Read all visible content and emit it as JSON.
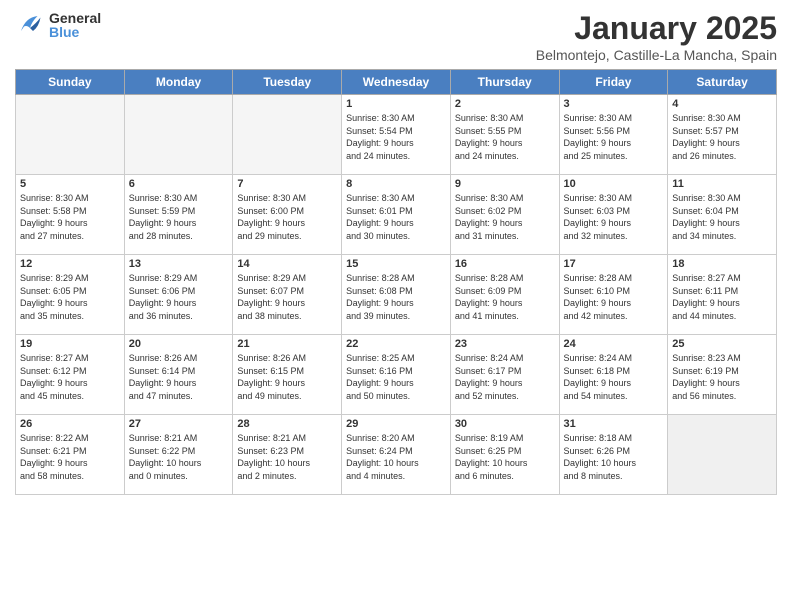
{
  "header": {
    "logo_general": "General",
    "logo_blue": "Blue",
    "title": "January 2025",
    "location": "Belmontejo, Castille-La Mancha, Spain"
  },
  "weekdays": [
    "Sunday",
    "Monday",
    "Tuesday",
    "Wednesday",
    "Thursday",
    "Friday",
    "Saturday"
  ],
  "weeks": [
    [
      {
        "day": "",
        "info": ""
      },
      {
        "day": "",
        "info": ""
      },
      {
        "day": "",
        "info": ""
      },
      {
        "day": "1",
        "info": "Sunrise: 8:30 AM\nSunset: 5:54 PM\nDaylight: 9 hours\nand 24 minutes."
      },
      {
        "day": "2",
        "info": "Sunrise: 8:30 AM\nSunset: 5:55 PM\nDaylight: 9 hours\nand 24 minutes."
      },
      {
        "day": "3",
        "info": "Sunrise: 8:30 AM\nSunset: 5:56 PM\nDaylight: 9 hours\nand 25 minutes."
      },
      {
        "day": "4",
        "info": "Sunrise: 8:30 AM\nSunset: 5:57 PM\nDaylight: 9 hours\nand 26 minutes."
      }
    ],
    [
      {
        "day": "5",
        "info": "Sunrise: 8:30 AM\nSunset: 5:58 PM\nDaylight: 9 hours\nand 27 minutes."
      },
      {
        "day": "6",
        "info": "Sunrise: 8:30 AM\nSunset: 5:59 PM\nDaylight: 9 hours\nand 28 minutes."
      },
      {
        "day": "7",
        "info": "Sunrise: 8:30 AM\nSunset: 6:00 PM\nDaylight: 9 hours\nand 29 minutes."
      },
      {
        "day": "8",
        "info": "Sunrise: 8:30 AM\nSunset: 6:01 PM\nDaylight: 9 hours\nand 30 minutes."
      },
      {
        "day": "9",
        "info": "Sunrise: 8:30 AM\nSunset: 6:02 PM\nDaylight: 9 hours\nand 31 minutes."
      },
      {
        "day": "10",
        "info": "Sunrise: 8:30 AM\nSunset: 6:03 PM\nDaylight: 9 hours\nand 32 minutes."
      },
      {
        "day": "11",
        "info": "Sunrise: 8:30 AM\nSunset: 6:04 PM\nDaylight: 9 hours\nand 34 minutes."
      }
    ],
    [
      {
        "day": "12",
        "info": "Sunrise: 8:29 AM\nSunset: 6:05 PM\nDaylight: 9 hours\nand 35 minutes."
      },
      {
        "day": "13",
        "info": "Sunrise: 8:29 AM\nSunset: 6:06 PM\nDaylight: 9 hours\nand 36 minutes."
      },
      {
        "day": "14",
        "info": "Sunrise: 8:29 AM\nSunset: 6:07 PM\nDaylight: 9 hours\nand 38 minutes."
      },
      {
        "day": "15",
        "info": "Sunrise: 8:28 AM\nSunset: 6:08 PM\nDaylight: 9 hours\nand 39 minutes."
      },
      {
        "day": "16",
        "info": "Sunrise: 8:28 AM\nSunset: 6:09 PM\nDaylight: 9 hours\nand 41 minutes."
      },
      {
        "day": "17",
        "info": "Sunrise: 8:28 AM\nSunset: 6:10 PM\nDaylight: 9 hours\nand 42 minutes."
      },
      {
        "day": "18",
        "info": "Sunrise: 8:27 AM\nSunset: 6:11 PM\nDaylight: 9 hours\nand 44 minutes."
      }
    ],
    [
      {
        "day": "19",
        "info": "Sunrise: 8:27 AM\nSunset: 6:12 PM\nDaylight: 9 hours\nand 45 minutes."
      },
      {
        "day": "20",
        "info": "Sunrise: 8:26 AM\nSunset: 6:14 PM\nDaylight: 9 hours\nand 47 minutes."
      },
      {
        "day": "21",
        "info": "Sunrise: 8:26 AM\nSunset: 6:15 PM\nDaylight: 9 hours\nand 49 minutes."
      },
      {
        "day": "22",
        "info": "Sunrise: 8:25 AM\nSunset: 6:16 PM\nDaylight: 9 hours\nand 50 minutes."
      },
      {
        "day": "23",
        "info": "Sunrise: 8:24 AM\nSunset: 6:17 PM\nDaylight: 9 hours\nand 52 minutes."
      },
      {
        "day": "24",
        "info": "Sunrise: 8:24 AM\nSunset: 6:18 PM\nDaylight: 9 hours\nand 54 minutes."
      },
      {
        "day": "25",
        "info": "Sunrise: 8:23 AM\nSunset: 6:19 PM\nDaylight: 9 hours\nand 56 minutes."
      }
    ],
    [
      {
        "day": "26",
        "info": "Sunrise: 8:22 AM\nSunset: 6:21 PM\nDaylight: 9 hours\nand 58 minutes."
      },
      {
        "day": "27",
        "info": "Sunrise: 8:21 AM\nSunset: 6:22 PM\nDaylight: 10 hours\nand 0 minutes."
      },
      {
        "day": "28",
        "info": "Sunrise: 8:21 AM\nSunset: 6:23 PM\nDaylight: 10 hours\nand 2 minutes."
      },
      {
        "day": "29",
        "info": "Sunrise: 8:20 AM\nSunset: 6:24 PM\nDaylight: 10 hours\nand 4 minutes."
      },
      {
        "day": "30",
        "info": "Sunrise: 8:19 AM\nSunset: 6:25 PM\nDaylight: 10 hours\nand 6 minutes."
      },
      {
        "day": "31",
        "info": "Sunrise: 8:18 AM\nSunset: 6:26 PM\nDaylight: 10 hours\nand 8 minutes."
      },
      {
        "day": "",
        "info": ""
      }
    ]
  ]
}
